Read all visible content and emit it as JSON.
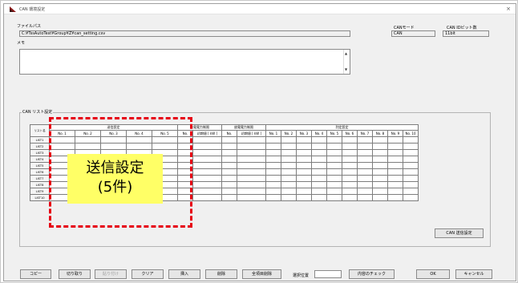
{
  "window": {
    "title": "CAN 環境設定",
    "close_glyph": "×",
    "accent": "#8b1a1a"
  },
  "file": {
    "label": "ファイルパス",
    "value": "C:¥TssAutoTest¥Group¥Z¥can_setting.csv"
  },
  "memo": {
    "label": "メモ"
  },
  "can_mode": {
    "label": "CANモード",
    "value": "CAN"
  },
  "can_id_bits": {
    "label": "CAN IDビット数",
    "value": "11bit"
  },
  "list_group": {
    "label": "CAN リスト設定"
  },
  "table": {
    "row_header_label": "リスト名",
    "groups": [
      "送信設定",
      "充電電力制限",
      "放電電力制限",
      "判定設定"
    ],
    "send_cols": [
      "No. 1",
      "No. 2",
      "No. 3",
      "No. 4",
      "No. 5"
    ],
    "charge_cols": [
      "No.",
      "初期値 [ kW ]"
    ],
    "discharge_cols": [
      "No.",
      "初期値 [ kW ]"
    ],
    "judge_cols": [
      "No. 1",
      "No. 2",
      "No. 3",
      "No. 4",
      "No. 5",
      "No. 6",
      "No. 7",
      "No. 8",
      "No. 9",
      "No. 10"
    ],
    "rows": [
      "LIST1",
      "LIST2",
      "LIST3",
      "LIST4",
      "LIST5",
      "LIST6",
      "LIST7",
      "LIST8",
      "LIST9",
      "LIST10"
    ]
  },
  "annotation": {
    "line1": "送信設定",
    "line2": "(5件)",
    "border_color": "#e60012",
    "fill": "#ffff66"
  },
  "can_send_button": "CAN 送信設定",
  "toolbar": {
    "copy": "コピー",
    "cut": "切り取り",
    "paste": "貼り付け",
    "clear": "クリア",
    "insert": "挿入",
    "delete": "削除",
    "delete_all": "全項目削除",
    "selection_label": "選択位置",
    "check": "内容のチェック",
    "ok": "OK",
    "cancel": "キャンセル"
  }
}
